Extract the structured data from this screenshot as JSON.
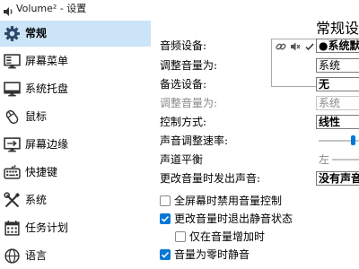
{
  "window": {
    "title": "Volume² - 设置",
    "icon": "volume-app-icon"
  },
  "colors": {
    "accent": "#0078d7",
    "selected_item_bg": "#cce4f7",
    "disabled_text": "#8a8a8a"
  },
  "sidebar": {
    "items": [
      {
        "label": "常规",
        "icon": "gear-icon",
        "selected": true
      },
      {
        "label": "屏幕菜单",
        "icon": "screen-menu-icon",
        "selected": false
      },
      {
        "label": "系统托盘",
        "icon": "system-tray-icon",
        "selected": false
      },
      {
        "label": "鼠标",
        "icon": "mouse-icon",
        "selected": false
      },
      {
        "label": "屏幕边缘",
        "icon": "screen-edge-icon",
        "selected": false
      },
      {
        "label": "快捷键",
        "icon": "keyboard-icon",
        "selected": false
      },
      {
        "label": "系统",
        "icon": "tools-icon",
        "selected": false
      },
      {
        "label": "任务计划",
        "icon": "calendar-icon",
        "selected": false
      },
      {
        "label": "语言",
        "icon": "globe-icon",
        "selected": false
      }
    ]
  },
  "main": {
    "heading": "常规设置",
    "audio_device": {
      "label": "音频设备:",
      "value": "●系统默认",
      "toolbar_icons": [
        "link-icon",
        "speaker-mute-icon",
        "check-icon"
      ]
    },
    "adjust_volume": {
      "label": "调整音量为:",
      "value": "系统"
    },
    "alternate_device": {
      "label": "备选设备:",
      "value": "无"
    },
    "alternate_adjust_volume": {
      "label": "调整音量为:",
      "value": "系统",
      "disabled": true
    },
    "control_mode": {
      "label": "控制方式:",
      "value": "线性"
    },
    "adjust_speed": {
      "label": "声音调整速率:"
    },
    "balance": {
      "label": "声道平衡",
      "left_label": "左"
    },
    "change_sound": {
      "label": "更改音量时发出声音:",
      "value": "没有声音"
    },
    "options": [
      {
        "label": "全屏幕时禁用音量控制",
        "checked": false
      },
      {
        "label": "更改音量时退出静音状态",
        "checked": true
      },
      {
        "label": "仅在音量增加时",
        "checked": false
      },
      {
        "label": "音量为零时静音",
        "checked": true
      }
    ]
  }
}
